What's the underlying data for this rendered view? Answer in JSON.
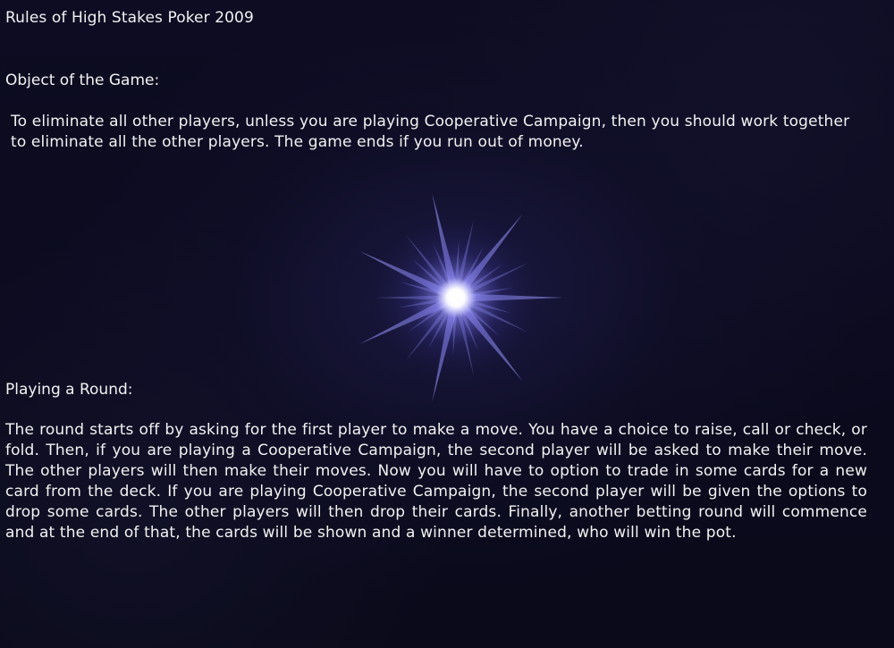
{
  "title": "Rules of High Stakes Poker 2009",
  "sections": [
    {
      "heading": "Object of the Game:",
      "body": "To eliminate all other players, unless you are playing Cooperative Campaign, then you should work together to eliminate all the other players. The game ends if you run out of money."
    },
    {
      "heading": "Playing a Round:",
      "body": "The round starts off by asking for the first player to make a move.  You have a choice to raise, call or check, or fold. Then, if you are playing a Cooperative Campaign, the second player will be asked to make their move. The other players will then make their moves. Now you will have to option to trade in some cards for a new card from the deck.  If you are playing Cooperative Campaign, the second player will be given the options to drop some cards. The other players will then drop their cards. Finally, another betting round will commence and at the end of that, the cards will be shown and a winner determined, who will win the pot."
    }
  ],
  "colors": {
    "background": "#0c0b1c",
    "text": "#f2f2f2",
    "flare": "#8f8cff"
  },
  "icons": {
    "flare": "star-flare"
  }
}
